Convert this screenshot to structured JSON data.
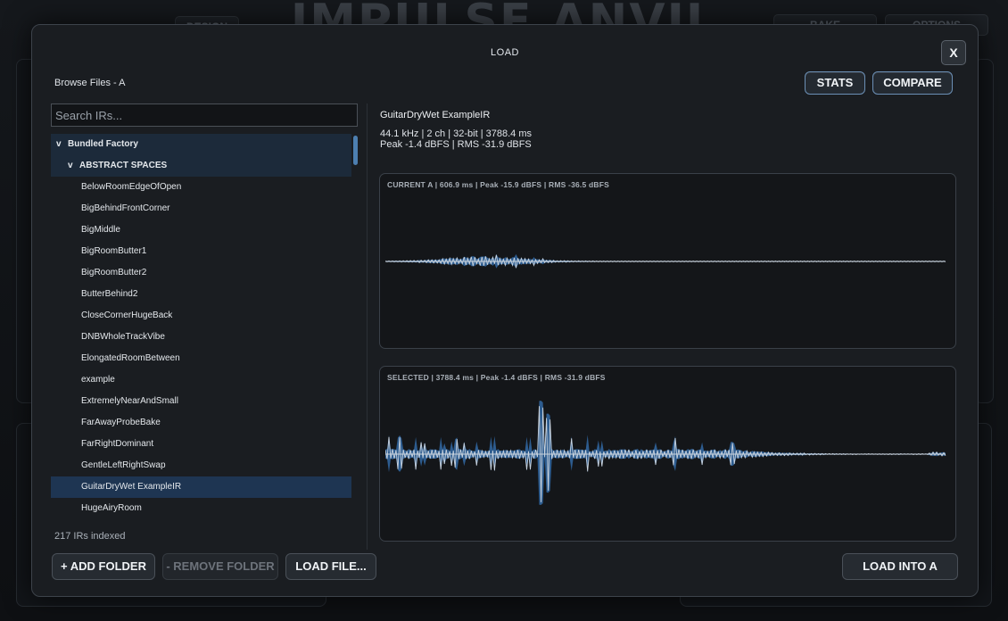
{
  "background": {
    "title": "IMPULSE ANVIL",
    "design_label": "DESIGN",
    "bake_label": "BAKE",
    "options_label": "OPTIONS"
  },
  "modal": {
    "title": "LOAD",
    "close_label": "X",
    "browse_label": "Browse Files - A",
    "stats_label": "STATS",
    "compare_label": "COMPARE"
  },
  "search": {
    "placeholder": "Search IRs..."
  },
  "tree": {
    "root_caret": "v",
    "root_label": "Bundled Factory",
    "folder_caret": "v",
    "folder_label": "ABSTRACT SPACES",
    "items": [
      "BelowRoomEdgeOfOpen",
      "BigBehindFrontCorner",
      "BigMiddle",
      "BigRoomButter1",
      "BigRoomButter2",
      "ButterBehind2",
      "CloseCornerHugeBack",
      "DNBWholeTrackVibe",
      "ElongatedRoomBetween",
      "example",
      "ExtremelyNearAndSmall",
      "FarAwayProbeBake",
      "FarRightDominant",
      "GentleLeftRightSwap",
      "GuitarDryWet ExampleIR",
      "HugeAiryRoom"
    ],
    "selected": "GuitarDryWet ExampleIR",
    "indexed_text": "217 IRs indexed"
  },
  "buttons": {
    "add_folder": "+ ADD FOLDER",
    "remove_folder": "- REMOVE FOLDER",
    "load_file": "LOAD FILE...",
    "load_into": "LOAD INTO A"
  },
  "details": {
    "name": "GuitarDryWet ExampleIR",
    "format_line": "44.1 kHz | 2 ch | 32-bit | 3788.4 ms",
    "level_line": "Peak -1.4 dBFS | RMS -31.9 dBFS"
  },
  "waves": {
    "current_label": "CURRENT A  |  606.9 ms  |  Peak -15.9 dBFS  |  RMS -36.5 dBFS",
    "selected_label": "SELECTED  |  3788.4 ms  |  Peak -1.4 dBFS  |  RMS -31.9 dBFS"
  },
  "colors": {
    "accent": "#4d7fb0",
    "wave_fill": "#2d5c8f",
    "wave_line": "#c9d3de",
    "selected_row": "#1e3552",
    "folder_row": "#1c2a3a"
  }
}
